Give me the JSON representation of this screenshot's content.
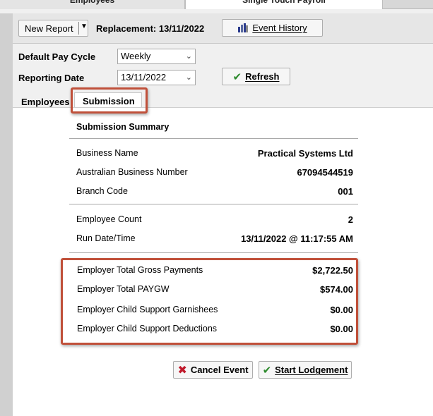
{
  "top_tabs": {
    "employees": "Employees",
    "stp": "Single Touch Payroll"
  },
  "toolbar": {
    "new_report": "New Report",
    "replacement": "Replacement: 13/11/2022",
    "event_history": "Event History"
  },
  "fields": {
    "pay_cycle_label": "Default Pay Cycle",
    "pay_cycle_value": "Weekly",
    "reporting_date_label": "Reporting Date",
    "reporting_date_value": "13/11/2022",
    "refresh": "Refresh"
  },
  "tabs": {
    "employees": "Employees",
    "submission": "Submission"
  },
  "summary": {
    "title": "Submission Summary",
    "business_name_label": "Business Name",
    "business_name": "Practical Systems Ltd",
    "abn_label": "Australian Business Number",
    "abn": "67094544519",
    "branch_label": "Branch Code",
    "branch": "001",
    "employee_count_label": "Employee Count",
    "employee_count": "2",
    "run_label": "Run Date/Time",
    "run": "13/11/2022 @ 11:17:55 AM",
    "gross_label": "Employer Total Gross Payments",
    "gross": "$2,722.50",
    "paygw_label": "Employer Total PAYGW",
    "paygw": "$574.00",
    "garnishees_label": "Employer Child Support Garnishees",
    "garnishees": "$0.00",
    "deductions_label": "Employer Child Support Deductions",
    "deductions": "$0.00"
  },
  "actions": {
    "cancel": "Cancel Event",
    "lodge": "Start Lodgement"
  },
  "colors": {
    "highlight": "#c0503a",
    "check": "#2e8b2e",
    "cross": "#c0182a"
  }
}
